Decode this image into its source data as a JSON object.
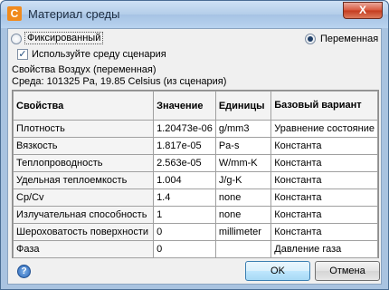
{
  "window": {
    "title": "Материал среды",
    "close_glyph": "X"
  },
  "options": {
    "fixed_label": "Фиксированный",
    "fixed_selected": false,
    "variable_label": "Переменная",
    "variable_selected": true,
    "use_scenario_label": "Используйте среду сценария",
    "use_scenario_checked": true
  },
  "info": {
    "line1": "Свойства Воздух (переменная)",
    "line2": "Среда: 101325 Pa, 19.85 Celsius (из сценария)"
  },
  "table": {
    "headers": [
      "Свойства",
      "Значение",
      "Единицы",
      "Базовый вариант"
    ],
    "rows": [
      [
        "Плотность",
        "1.20473e-06",
        "g/mm3",
        "Уравнение состояние"
      ],
      [
        "Вязкость",
        "1.817e-05",
        "Pa-s",
        "Константа"
      ],
      [
        "Теплопроводность",
        "2.563e-05",
        "W/mm-K",
        "Константа"
      ],
      [
        "Удельная теплоемкость",
        "1.004",
        "J/g-K",
        "Константа"
      ],
      [
        "Cp/Cv",
        "1.4",
        "none",
        "Константа"
      ],
      [
        "Излучательная способность",
        "1",
        "none",
        "Константа"
      ],
      [
        "Шероховатость поверхности",
        "0",
        "millimeter",
        "Константа"
      ],
      [
        "Фаза",
        "0",
        "",
        "Давление газа"
      ]
    ]
  },
  "footer": {
    "help_glyph": "?",
    "ok_label": "OK",
    "cancel_label": "Отмена"
  },
  "colors": {
    "title_text": "#1b2b3f",
    "close_button": "#c43b1e",
    "default_button_border": "#3c7fb1"
  }
}
